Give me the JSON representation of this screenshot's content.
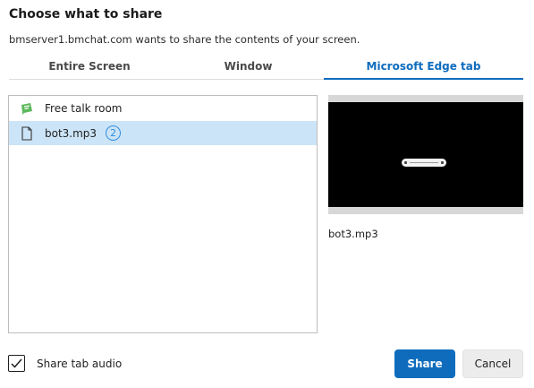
{
  "dialog": {
    "title": "Choose what to share",
    "subtitle": "bmserver1.bmchat.com wants to share the contents of your screen."
  },
  "tabs": [
    {
      "label": "Entire Screen",
      "selected": false
    },
    {
      "label": "Window",
      "selected": false
    },
    {
      "label": "Microsoft Edge tab",
      "selected": true
    }
  ],
  "list": {
    "items": [
      {
        "label": "Free talk room",
        "icon": "chat-room-icon",
        "selected": false
      },
      {
        "label": "bot3.mp3",
        "icon": "document-icon",
        "selected": true,
        "badge": "2"
      }
    ]
  },
  "preview": {
    "label": "bot3.mp3"
  },
  "footer": {
    "audio_label": "Share tab audio",
    "audio_checked": true,
    "share_label": "Share",
    "cancel_label": "Cancel"
  },
  "colors": {
    "accent": "#0f6cbd",
    "selected_row": "#cce4f7",
    "badge": "#2f8ee0",
    "room_icon": "#5cb85c"
  }
}
